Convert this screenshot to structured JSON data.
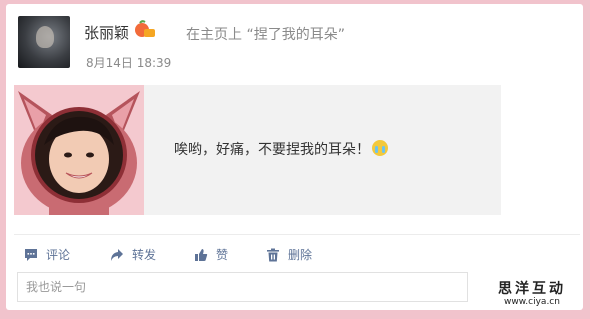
{
  "post": {
    "username": "张丽颖",
    "action": "在主页上 “捏了我的耳朵”",
    "timestamp": "8月14日 18:39",
    "content": "唉哟，好痛，不要捏我的耳朵！",
    "emoji": "cry-emoji"
  },
  "actions": [
    {
      "label": "评论",
      "icon": "comment-icon"
    },
    {
      "label": "转发",
      "icon": "share-icon"
    },
    {
      "label": "赞",
      "icon": "like-icon"
    },
    {
      "label": "删除",
      "icon": "delete-icon"
    }
  ],
  "comment": {
    "placeholder": "我也说一句"
  },
  "watermark": {
    "main": "思洋互动",
    "url": "www.ciya.cn"
  },
  "colors": {
    "background": "#f1c3cc",
    "link": "#5e7397",
    "content_bg": "#f2f2f2"
  }
}
